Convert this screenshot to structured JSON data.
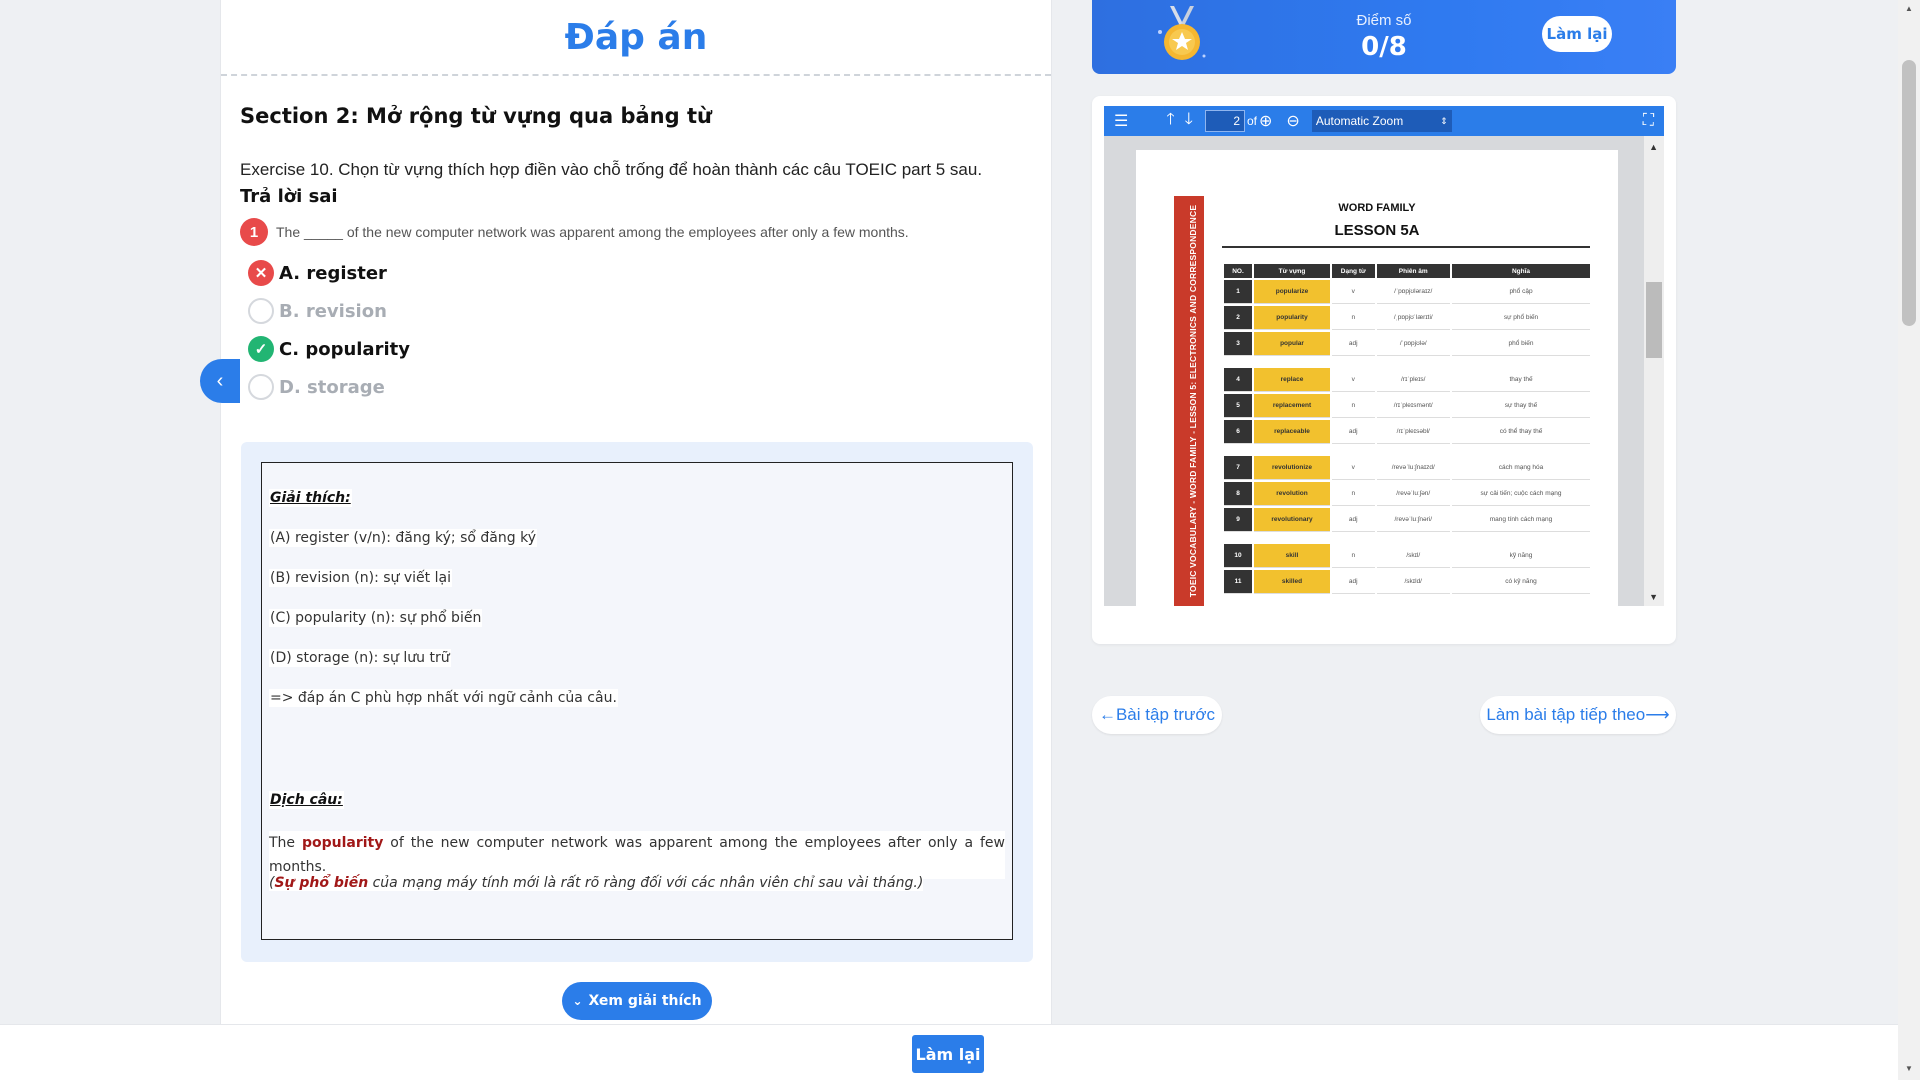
{
  "left": {
    "title": "Đáp án",
    "section_title": "Section 2: Mở rộng từ vựng qua bảng từ",
    "exercise": "Exercise 10. Chọn từ vựng thích hợp điền vào chỗ trống để hoàn thành các câu TOEIC part 5 sau.",
    "result": "Trả lời sai",
    "question_number": "1",
    "question_text": "The _____ of the new computer network was apparent among the employees after only a few months.",
    "options": [
      {
        "label": "A. register",
        "state": "wrong"
      },
      {
        "label": "B. revision",
        "state": "unselected"
      },
      {
        "label": "C. popularity",
        "state": "correct"
      },
      {
        "label": "D. storage",
        "state": "unselected"
      }
    ],
    "explanation": {
      "heading": "Giải thích:",
      "lines": [
        "(A) register (v/n): đăng ký; sổ đăng ký",
        "(B) revision (n): sự viết lại",
        "(C) popularity (n): sự phổ biến",
        "(D) storage (n): sự lưu trữ",
        "=> đáp án C phù hợp nhất với ngữ cảnh của câu."
      ],
      "translation_heading": "Dịch câu:",
      "translation_before": "The ",
      "translation_highlight": "popularity",
      "translation_after": " of the new computer network was apparent among the employees after only a few months.",
      "vi_open": "(",
      "vi_highlight": "Sự phổ biến",
      "vi_after": " của mạng máy tính mới là rất rõ ràng đối với các nhân viên chỉ sau vài tháng.)"
    },
    "show_explanation_button": "Xem giải thích"
  },
  "score": {
    "label": "Điểm số",
    "value": "0/8",
    "retry_button": "Làm lại"
  },
  "pdf": {
    "page_number": "2",
    "of_label": "of",
    "zoom": "Automatic Zoom",
    "side_title": "TOEIC VOCABULARY - WORD FAMILY - LESSON 5: ELECTRONICS AND CORRESPONDENCE",
    "doc_title": "WORD FAMILY",
    "lesson": "LESSON 5A",
    "headers": [
      "NO.",
      "Từ vựng",
      "Dạng từ",
      "Phiên âm",
      "Nghĩa"
    ],
    "rows": [
      {
        "no": "1",
        "word": "popularize",
        "type": "v",
        "ipa": "/ˈpɒpjʊləraɪz/",
        "meaning": "phổ cập"
      },
      {
        "no": "2",
        "word": "popularity",
        "type": "n",
        "ipa": "/ˌpɒpjʊˈlærɪti/",
        "meaning": "sự phổ biến"
      },
      {
        "no": "3",
        "word": "popular",
        "type": "adj",
        "ipa": "/ˈpɒpjʊlə/",
        "meaning": "phổ biến"
      },
      {
        "no": "4",
        "word": "replace",
        "type": "v",
        "ipa": "/rɪˈpleɪs/",
        "meaning": "thay thế"
      },
      {
        "no": "5",
        "word": "replacement",
        "type": "n",
        "ipa": "/rɪˈpleɪsmənt/",
        "meaning": "sự thay thế"
      },
      {
        "no": "6",
        "word": "replaceable",
        "type": "adj",
        "ipa": "/rɪˈpleɪsəbl/",
        "meaning": "có thể thay thế"
      },
      {
        "no": "7",
        "word": "revolutionize",
        "type": "v",
        "ipa": "/revəˈluːʃnaɪzd/",
        "meaning": "cách mạng hóa"
      },
      {
        "no": "8",
        "word": "revolution",
        "type": "n",
        "ipa": "/revəˈluːʃən/",
        "meaning": "sự cải tiến; cuộc cách mạng"
      },
      {
        "no": "9",
        "word": "revolutionary",
        "type": "adj",
        "ipa": "/revəˈluːʃnəri/",
        "meaning": "mang tính cách mạng"
      },
      {
        "no": "10",
        "word": "skill",
        "type": "n",
        "ipa": "/skɪl/",
        "meaning": "kỹ năng"
      },
      {
        "no": "11",
        "word": "skilled",
        "type": "adj",
        "ipa": "/skɪld/",
        "meaning": "có kỹ năng"
      }
    ]
  },
  "nav": {
    "prev": "←Bài tập trước",
    "next": "Làm bài tập tiếp theo⟶"
  },
  "bottom": {
    "retry_button": "Làm lại"
  },
  "colors": {
    "primary": "#2b7de9",
    "wrong": "#e84a4a",
    "correct": "#22b573",
    "highlight": "#a11818"
  }
}
